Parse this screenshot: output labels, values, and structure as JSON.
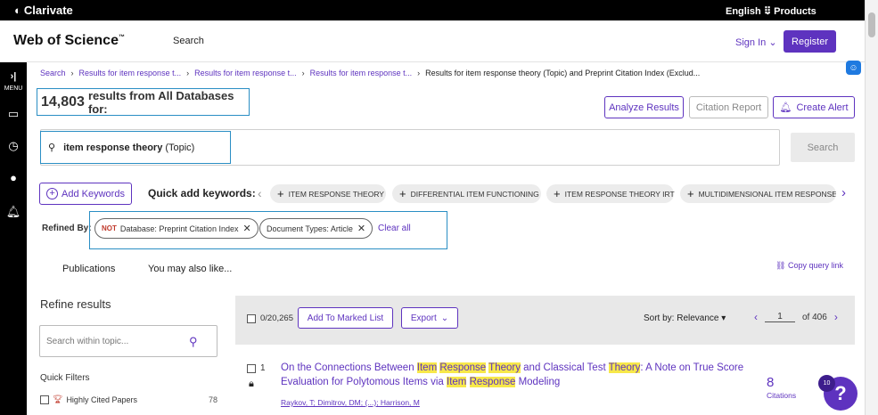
{
  "brand": {
    "name": "Clarivate",
    "language": "English",
    "products": "Products"
  },
  "appbar": {
    "title": "Web of Science",
    "tm": "™",
    "search_link": "Search",
    "sign_in": "Sign In",
    "register": "Register"
  },
  "sidebar": {
    "menu": "MENU"
  },
  "breadcrumbs": [
    "Search",
    "Results for item response t...",
    "Results for item response t...",
    "Results for item response t...",
    "Results for item response theory (Topic) and Preprint Citation Index (Exclud..."
  ],
  "results": {
    "count": "14,803",
    "label": "results from All Databases for:"
  },
  "actions": {
    "analyze": "Analyze Results",
    "citation_report": "Citation Report",
    "create_alert": "Create Alert"
  },
  "query": {
    "term": "item response theory",
    "field": "(Topic)",
    "search_button": "Search"
  },
  "keywords": {
    "add": "Add Keywords",
    "quick_label": "Quick add keywords:",
    "chips": [
      "ITEM RESPONSE THEORY",
      "DIFFERENTIAL ITEM FUNCTIONING",
      "ITEM RESPONSE THEORY IRT",
      "MULTIDIMENSIONAL ITEM RESPONSE"
    ]
  },
  "refined": {
    "label": "Refined By:",
    "not": "NOT",
    "chip1": "Database: Preprint Citation Index",
    "chip2": "Document Types: Article",
    "clear": "Clear all"
  },
  "tabs": {
    "publications": "Publications",
    "also_like": "You may also like...",
    "copy_query": "Copy query link"
  },
  "refine": {
    "title": "Refine results",
    "search_placeholder": "Search within topic...",
    "quick_filters": "Quick Filters",
    "highly_cited": "Highly Cited Papers",
    "highly_cited_count": "78"
  },
  "toolbar": {
    "selected": "0/20,265",
    "marked": "Add To Marked List",
    "export": "Export",
    "sort": "Sort by: Relevance",
    "page": "1",
    "of": "of 406"
  },
  "record": {
    "index": "1",
    "title_parts": [
      "On the Connections Between ",
      "Item",
      " ",
      "Response",
      " ",
      "Theory",
      " and Classical Test ",
      "Theory",
      ": A Note on True Score Evaluation for Polytomous Items via ",
      "Item",
      " ",
      "Response",
      " Modeling"
    ],
    "authors": "Raykov, T; Dimitrov, DM; (...); Harrison, M",
    "citations": "8",
    "citations_label": "Citations"
  },
  "help": {
    "badge": "10",
    "icon": "?"
  }
}
